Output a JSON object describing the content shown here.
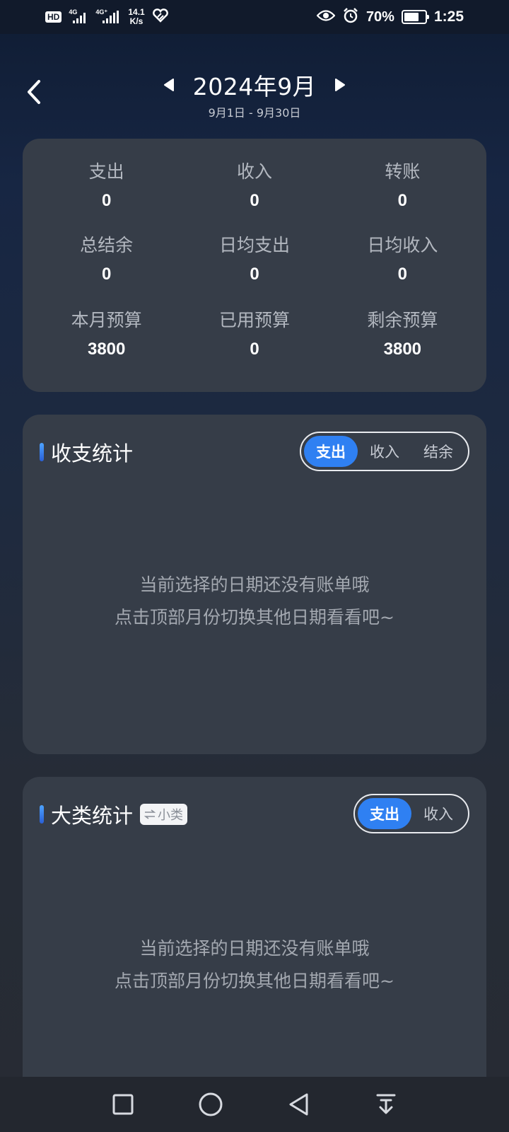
{
  "status_bar": {
    "hd": "HD",
    "sim1_net": "4G",
    "sim2_net": "4G⁺",
    "speed_value": "14.1",
    "speed_unit": "K/s",
    "battery_percent": "70%",
    "battery_level": 0.7,
    "time": "1:25",
    "icons": [
      "hd-icon",
      "signal-icon",
      "signal-icon",
      "heart-app-icon",
      "eye-icon",
      "alarm-icon",
      "battery-icon"
    ]
  },
  "header": {
    "title": "2024年9月",
    "date_range": "9月1日 - 9月30日",
    "back_icon": "chevron-left-icon",
    "prev_icon": "triangle-left-icon",
    "next_icon": "triangle-right-icon"
  },
  "summary": {
    "items": [
      {
        "label": "支出",
        "value": "0"
      },
      {
        "label": "收入",
        "value": "0"
      },
      {
        "label": "转账",
        "value": "0"
      },
      {
        "label": "总结余",
        "value": "0"
      },
      {
        "label": "日均支出",
        "value": "0"
      },
      {
        "label": "日均收入",
        "value": "0"
      },
      {
        "label": "本月预算",
        "value": "3800"
      },
      {
        "label": "已用预算",
        "value": "0"
      },
      {
        "label": "剩余预算",
        "value": "3800"
      }
    ]
  },
  "income_expense_stats": {
    "title": "收支统计",
    "tabs": [
      "支出",
      "收入",
      "结余"
    ],
    "active_tab": "支出",
    "empty_line1": "当前选择的日期还没有账单哦",
    "empty_line2": "点击顶部月份切换其他日期看看吧~"
  },
  "category_stats": {
    "title": "大类统计",
    "toggle_label": "小类",
    "tabs": [
      "支出",
      "收入"
    ],
    "active_tab": "支出",
    "empty_line1": "当前选择的日期还没有账单哦",
    "empty_line2": "点击顶部月份切换其他日期看看吧~"
  },
  "nav_bar": {
    "icons": [
      "square-icon",
      "circle-icon",
      "triangle-back-icon",
      "dropdown-icon"
    ]
  },
  "colors": {
    "accent": "#2f80f2",
    "card": "#363d48"
  }
}
